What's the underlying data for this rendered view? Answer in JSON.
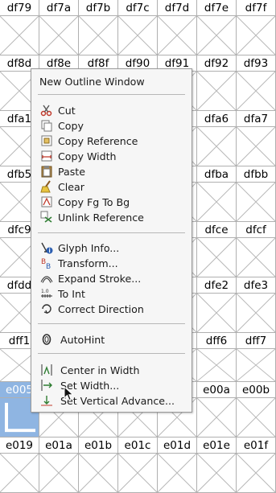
{
  "grid": {
    "rows": [
      [
        "df79",
        "df7a",
        "df7b",
        "df7c",
        "df7d",
        "df7e",
        "df7f"
      ],
      [
        "df8d",
        "df8e",
        "df8f",
        "df90",
        "df91",
        "df92",
        "df93"
      ],
      [
        "dfa1",
        "",
        "",
        "",
        "",
        "dfa6",
        "dfa7"
      ],
      [
        "dfb5",
        "",
        "",
        "",
        "",
        "dfba",
        "dfbb"
      ],
      [
        "dfc9",
        "",
        "",
        "",
        "",
        "dfce",
        "dfcf"
      ],
      [
        "dfdd",
        "",
        "",
        "",
        "",
        "dfe2",
        "dfe3"
      ],
      [
        "dff1",
        "",
        "",
        "",
        "",
        "dff6",
        "dff7"
      ],
      [
        "e005",
        "",
        "",
        "",
        "",
        "e00a",
        "e00b"
      ],
      [
        "e019",
        "e01a",
        "e01b",
        "e01c",
        "e01d",
        "e01e",
        "e01f"
      ]
    ],
    "selected_cell": "e005"
  },
  "context_menu": {
    "items": [
      {
        "label": "New Outline Window",
        "icon": ""
      },
      {
        "separator": true
      },
      {
        "label": "Cut",
        "icon": "scissors-icon"
      },
      {
        "label": "Copy",
        "icon": "copy-icon"
      },
      {
        "label": "Copy Reference",
        "icon": "copy-reference-icon"
      },
      {
        "label": "Copy Width",
        "icon": "copy-width-icon"
      },
      {
        "label": "Paste",
        "icon": "paste-icon"
      },
      {
        "label": "Clear",
        "icon": "broom-icon"
      },
      {
        "label": "Copy Fg To Bg",
        "icon": "copy-fg-to-bg-icon"
      },
      {
        "label": "Unlink Reference",
        "icon": "unlink-reference-icon"
      },
      {
        "separator": true
      },
      {
        "label": "Glyph Info...",
        "icon": "glyph-info-icon"
      },
      {
        "label": "Transform...",
        "icon": "transform-icon"
      },
      {
        "label": "Expand Stroke...",
        "icon": "expand-stroke-icon"
      },
      {
        "label": "To Int",
        "icon": "to-int-icon"
      },
      {
        "label": "Correct Direction",
        "icon": "correct-direction-icon"
      },
      {
        "separator": true
      },
      {
        "label": "AutoHint",
        "icon": "autohint-icon"
      },
      {
        "separator": true
      },
      {
        "label": "Center in Width",
        "icon": "center-in-width-icon"
      },
      {
        "label": "Set Width...",
        "icon": "set-width-icon"
      },
      {
        "label": "Set Vertical Advance...",
        "icon": "set-vertical-advance-icon"
      }
    ]
  },
  "colors": {
    "selection": "#8fb5e2",
    "grid_line": "#b0b0b0",
    "menu_bg": "#f6f6f6"
  }
}
